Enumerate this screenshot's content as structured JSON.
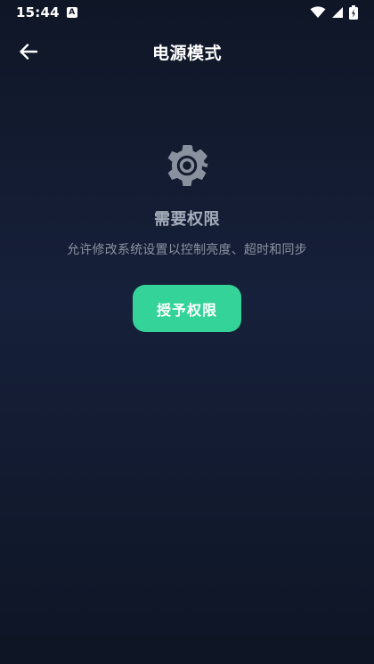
{
  "status_bar": {
    "time": "15:44",
    "notification_icon": "a-icon",
    "wifi_icon": "wifi-icon",
    "signal_icon": "signal-icon",
    "battery_icon": "battery-charging-icon"
  },
  "app_bar": {
    "back_icon": "back-arrow-icon",
    "title": "电源模式"
  },
  "permission": {
    "icon": "gear-icon",
    "title": "需要权限",
    "description": "允许修改系统设置以控制亮度、超时和同步",
    "grant_label": "授予权限"
  },
  "colors": {
    "background": "#121a2c",
    "accent": "#34d399",
    "title_text": "#a5adbb",
    "desc_text": "#8b93a3"
  }
}
